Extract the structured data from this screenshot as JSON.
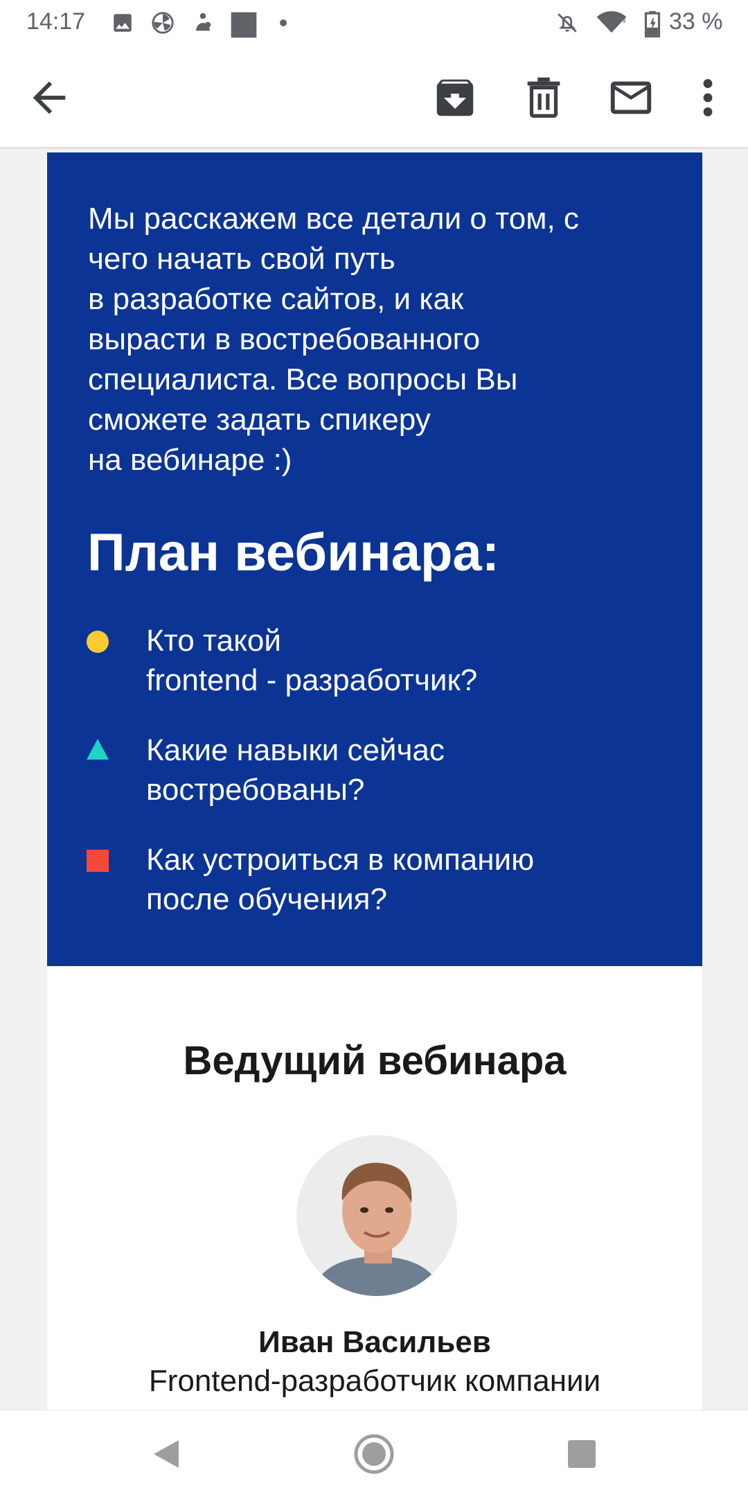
{
  "status_bar": {
    "time": "14:17",
    "battery": "33 %",
    "icons": [
      "image-icon",
      "pinwheel-icon",
      "app-notification-icon",
      "square-app-icon",
      "dot-icon",
      "notifications-off-icon",
      "wifi-icon",
      "battery-icon"
    ]
  },
  "app_bar": {
    "icons": [
      "back-arrow-icon",
      "archive-icon",
      "delete-icon",
      "mark-unread-icon",
      "more-vert-icon"
    ]
  },
  "email": {
    "intro_lines": [
      "Мы расскажем все детали о том, с",
      "чего начать свой путь",
      "в разработке сайтов, и как",
      "вырасти в востребованного",
      "специалиста. Все вопросы Вы",
      "сможете задать спикеру",
      "на вебинаре :)"
    ],
    "plan_title": "План вебинара:",
    "plan_items": [
      {
        "marker": "circle",
        "color": "#fdcb2e",
        "lines": [
          "Кто такой",
          "frontend - разработчик?"
        ]
      },
      {
        "marker": "triangle",
        "color": "#1dd3c3",
        "lines": [
          "Какие навыки сейчас",
          "востребованы?"
        ]
      },
      {
        "marker": "square",
        "color": "#f4493a",
        "lines": [
          "Как устроиться в компанию",
          "после обучения?"
        ]
      }
    ],
    "host_title": "Ведущий вебинара",
    "host_name": "Иван Васильев",
    "host_role": "Frontend-разработчик компании"
  },
  "colors": {
    "block_background": "#0b3495",
    "text_dark": "#1a1a1a",
    "icon_gray": "#5f6368"
  },
  "nav_bar": {
    "icons": [
      "back-triangle-icon",
      "home-circle-icon",
      "recents-square-icon"
    ]
  }
}
